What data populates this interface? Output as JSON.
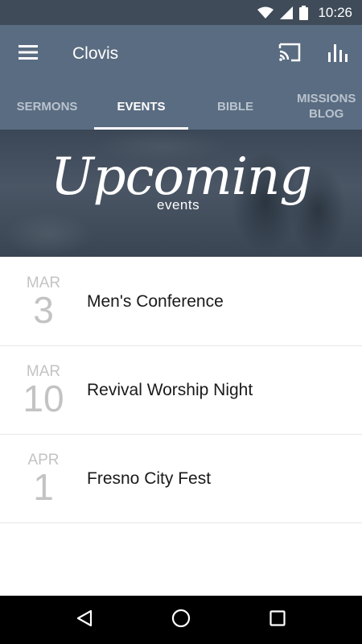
{
  "status_bar": {
    "time": "10:26",
    "icons": [
      "wifi-icon",
      "signal-icon",
      "battery-icon"
    ]
  },
  "app_bar": {
    "title": "Clovis",
    "left_icon": "menu-icon",
    "actions": [
      "cast-icon",
      "chart-icon"
    ]
  },
  "tabs": [
    {
      "label": "SERMONS",
      "active": false
    },
    {
      "label": "EVENTS",
      "active": true
    },
    {
      "label": "BIBLE",
      "active": false
    },
    {
      "label": "MISSIONS BLOG",
      "active": false
    }
  ],
  "banner": {
    "title": "Upcoming",
    "subtitle": "events"
  },
  "events": [
    {
      "month": "MAR",
      "day": "3",
      "name": "Men's Conference"
    },
    {
      "month": "MAR",
      "day": "10",
      "name": "Revival Worship Night"
    },
    {
      "month": "APR",
      "day": "1",
      "name": "Fresno City Fest"
    }
  ],
  "nav_bar": {
    "buttons": [
      "back-icon",
      "home-icon",
      "recents-icon"
    ]
  },
  "colors": {
    "status_bar": "#3f4b58",
    "app_bar": "#5a6c81",
    "tab_inactive": "#b9c3cf",
    "tab_active": "#ffffff",
    "date_text": "#c3c3c3"
  }
}
